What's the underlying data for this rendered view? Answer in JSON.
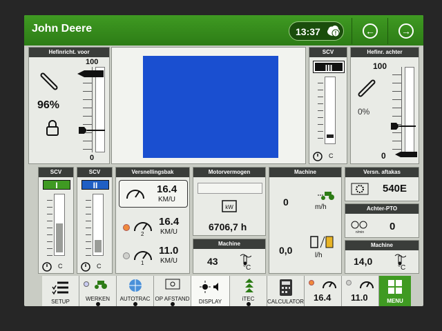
{
  "topbar": {
    "brand": "John Deere",
    "clock": "13:37"
  },
  "hitch_front": {
    "title": "Hefinricht. voor",
    "max": "100",
    "min": "0",
    "percent": "96%",
    "level": 0.96
  },
  "video": {
    "color": "#1a4fd0"
  },
  "scv_top": {
    "title": "SCV",
    "roman": "III",
    "unit_label": "C"
  },
  "hitch_rear": {
    "title": "Hefinr. achter",
    "max": "100",
    "min": "0",
    "percent": "0%",
    "level": 0.0
  },
  "scv_1": {
    "title": "SCV",
    "roman": "I",
    "unit_label": "C",
    "level": 0.5
  },
  "scv_2": {
    "title": "SCV",
    "roman": "II",
    "unit_label": "C",
    "level": 0.25
  },
  "gearbox": {
    "title": "Versnellingsbak",
    "rows": [
      {
        "value": "16.4",
        "unit": "KM/U"
      },
      {
        "value": "16.4",
        "unit": "KM/U",
        "gear": "2"
      },
      {
        "value": "11.0",
        "unit": "KM/U",
        "gear": "1"
      }
    ]
  },
  "power": {
    "title": "Motorvermogen",
    "icon_text": "kW",
    "hours": "6706,7 h"
  },
  "machine_temp": {
    "title": "Machine",
    "value": "43",
    "unit": "°C"
  },
  "machine_mid": {
    "title": "Machine",
    "speed": "0",
    "speed_unit": "m/h",
    "fuel": "0,0",
    "fuel_unit": "l/h"
  },
  "pto": {
    "title": "Versn. aftakas",
    "value": "540E"
  },
  "rear_pto": {
    "title": "Achter-PTO",
    "value": "0",
    "icon_text": "n/min"
  },
  "machine_right": {
    "title": "Machine",
    "value": "14,0",
    "unit": "°C"
  },
  "buttons": {
    "setup": "SETUP",
    "werken": "WERKEN",
    "autotrac": "AUTOTRAC",
    "op_afstand": "OP AFSTAND",
    "display": "DISPLAY",
    "itec": "iTEC",
    "calculator": "CALCULATOR",
    "speed_a": "16.4",
    "speed_b": "11.0",
    "menu": "MENU"
  }
}
